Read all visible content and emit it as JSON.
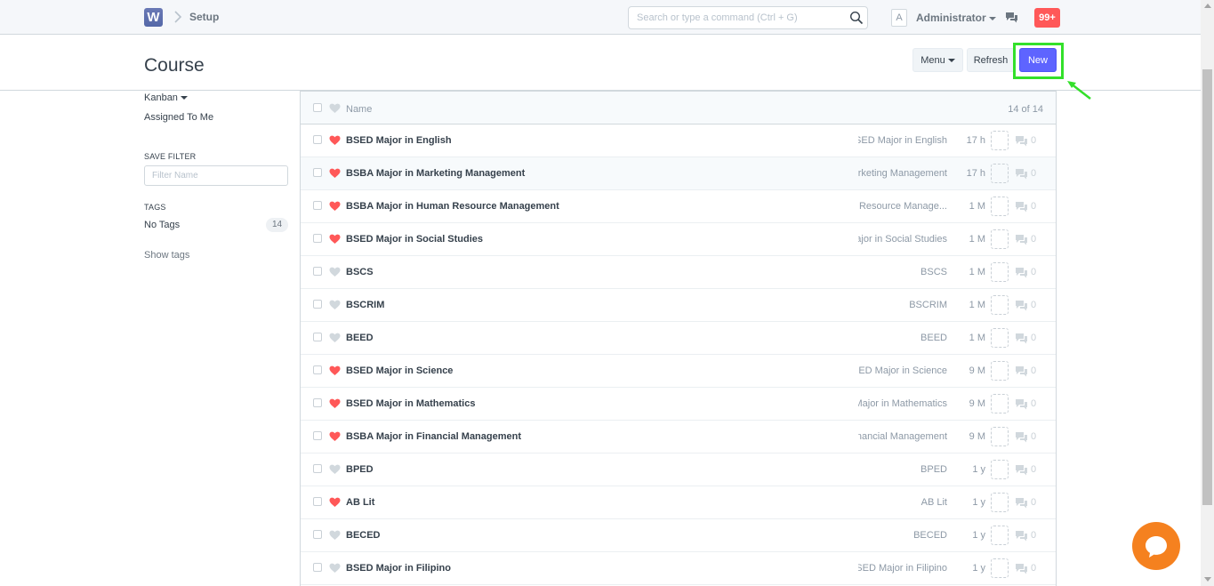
{
  "navbar": {
    "logo_letter": "W",
    "breadcrumb": "Setup",
    "search_placeholder": "Search or type a command (Ctrl + G)",
    "avatar_letter": "A",
    "user_name": "Administrator",
    "notification_count": "99+"
  },
  "page": {
    "title": "Course",
    "menu_label": "Menu",
    "refresh_label": "Refresh",
    "new_label": "New"
  },
  "sidebar": {
    "kanban_label": "Kanban",
    "assigned_label": "Assigned To Me",
    "save_filter_label": "SAVE FILTER",
    "filter_placeholder": "Filter Name",
    "tags_label": "TAGS",
    "no_tags_label": "No Tags",
    "no_tags_count": "14",
    "show_tags_label": "Show tags"
  },
  "list": {
    "header_name": "Name",
    "count_label": "14 of 14",
    "rows": [
      {
        "name": "BSED Major in English",
        "desc": "BSED Major in English",
        "time": "17 h",
        "liked": true,
        "comments": "0"
      },
      {
        "name": "BSBA Major in Marketing Management",
        "desc": "BSBA Major in Marketing Management",
        "time": "17 h",
        "liked": true,
        "comments": "0"
      },
      {
        "name": "BSBA Major in Human Resource Management",
        "desc": "Resource Manage...",
        "time": "1 M",
        "liked": true,
        "comments": "0"
      },
      {
        "name": "BSED Major in Social Studies",
        "desc": "BSED Major in Social Studies",
        "time": "1 M",
        "liked": true,
        "comments": "0"
      },
      {
        "name": "BSCS",
        "desc": "BSCS",
        "time": "1 M",
        "liked": false,
        "comments": "0"
      },
      {
        "name": "BSCRIM",
        "desc": "BSCRIM",
        "time": "1 M",
        "liked": false,
        "comments": "0"
      },
      {
        "name": "BEED",
        "desc": "BEED",
        "time": "1 M",
        "liked": false,
        "comments": "0"
      },
      {
        "name": "BSED Major in Science",
        "desc": "BSED Major in Science",
        "time": "9 M",
        "liked": true,
        "comments": "0"
      },
      {
        "name": "BSED Major in Mathematics",
        "desc": "BSED Major in Mathematics",
        "time": "9 M",
        "liked": true,
        "comments": "0"
      },
      {
        "name": "BSBA Major in Financial Management",
        "desc": "BSBA Major in Financial Management",
        "time": "9 M",
        "liked": true,
        "comments": "0"
      },
      {
        "name": "BPED",
        "desc": "BPED",
        "time": "1 y",
        "liked": false,
        "comments": "0"
      },
      {
        "name": "AB Lit",
        "desc": "AB Lit",
        "time": "1 y",
        "liked": true,
        "comments": "0"
      },
      {
        "name": "BECED",
        "desc": "BECED",
        "time": "1 y",
        "liked": false,
        "comments": "0"
      },
      {
        "name": "BSED Major in Filipino",
        "desc": "BSED Major in Filipino",
        "time": "1 y",
        "liked": false,
        "comments": "0"
      }
    ]
  },
  "colors": {
    "primary": "#5e64ff",
    "heart_liked": "#ff5858",
    "heart_unliked": "#d1d8dd",
    "notification": "#ff5858",
    "highlight": "#33e02a",
    "chat_widget": "#f5811f"
  }
}
